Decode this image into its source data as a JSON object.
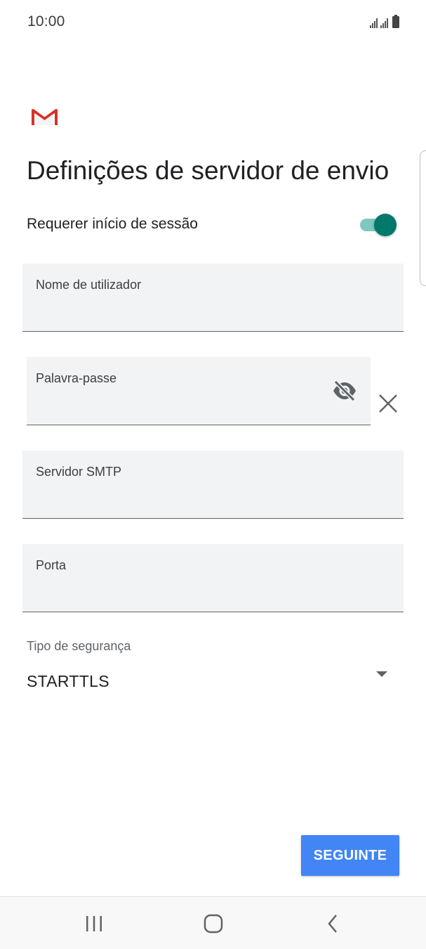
{
  "status_bar": {
    "time": "10:00"
  },
  "app": {
    "logo_icon": "gmail-icon",
    "title": "Definições de servidor de envio"
  },
  "require_login": {
    "label": "Requerer início de sessão",
    "enabled": true
  },
  "fields": {
    "username": {
      "label": "Nome de utilizador",
      "value": ""
    },
    "password": {
      "label": "Palavra-passe",
      "value": ""
    },
    "smtp_server": {
      "label": "Servidor SMTP",
      "value": ""
    },
    "port": {
      "label": "Porta",
      "value": ""
    }
  },
  "security": {
    "label": "Tipo de segurança",
    "selected": "STARTTLS"
  },
  "actions": {
    "next_label": "SEGUINTE"
  },
  "colors": {
    "accent": "#00796b",
    "accent_track": "#7fc7c0",
    "button": "#4285f4",
    "field_bg": "#f1f3f4"
  }
}
